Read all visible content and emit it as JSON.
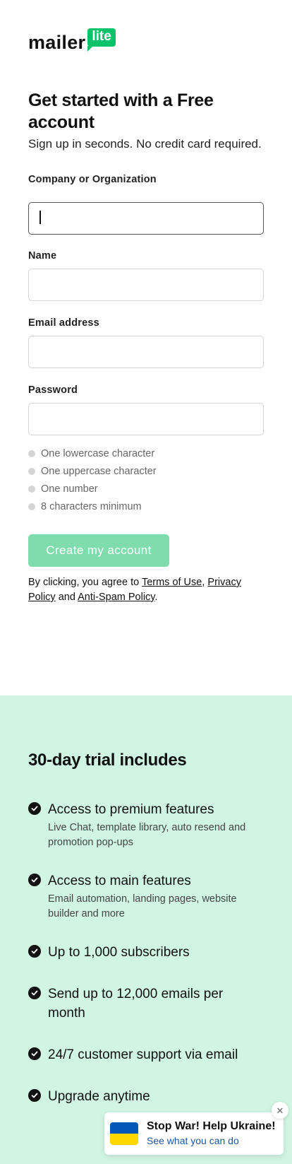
{
  "logo": {
    "word": "mailer",
    "badge": "lite",
    "brand_color": "#09c269"
  },
  "header": {
    "title": "Get started with a Free account",
    "subtitle": "Sign up in seconds. No credit card required."
  },
  "form": {
    "company": {
      "label": "Company or Organization",
      "value": ""
    },
    "name": {
      "label": "Name",
      "value": ""
    },
    "email": {
      "label": "Email address",
      "value": ""
    },
    "password": {
      "label": "Password",
      "value": ""
    },
    "password_rules": [
      "One lowercase character",
      "One uppercase character",
      "One number",
      "8 characters minimum"
    ],
    "submit_label": "Create my account",
    "submit_color": "#7fdcad"
  },
  "legal": {
    "prefix": "By clicking, you agree to ",
    "terms": "Terms of Use",
    "comma": ", ",
    "privacy": "Privacy Policy",
    "and": " and ",
    "antispam": "Anti-Spam Policy",
    "period": "."
  },
  "trial": {
    "background": "#d0f5e3",
    "title": "30-day trial includes",
    "features": [
      {
        "title": "Access to premium features",
        "desc": "Live Chat, template library, auto resend and promotion pop-ups"
      },
      {
        "title": "Access to main features",
        "desc": "Email automation, landing pages, website builder and more"
      },
      {
        "title": "Up to 1,000 subscribers"
      },
      {
        "title": "Send up to 12,000 emails per month"
      },
      {
        "title": "24/7 customer support via email"
      },
      {
        "title": "Upgrade anytime"
      }
    ]
  },
  "ukraine_banner": {
    "title": "Stop War! Help Ukraine!",
    "link": "See what you can do",
    "close_icon": "close-icon",
    "flag_colors": [
      "#0057b7",
      "#ffd700"
    ]
  }
}
